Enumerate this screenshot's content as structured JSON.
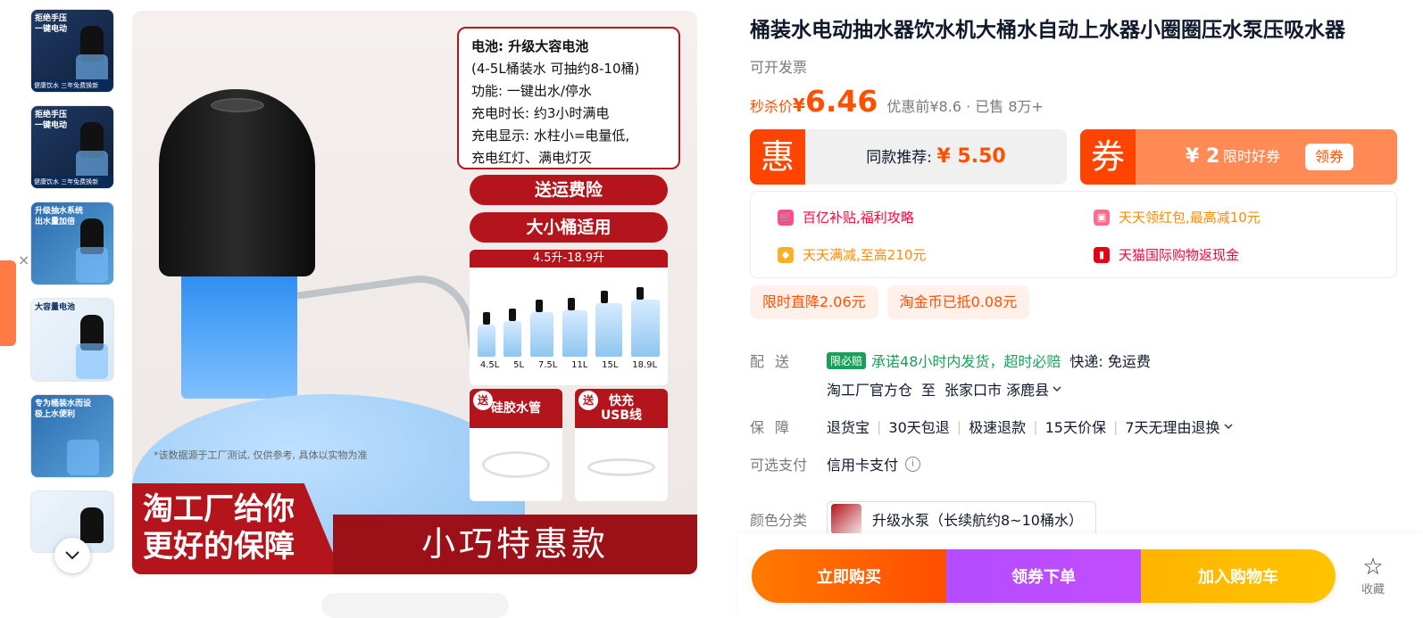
{
  "thumbnails": [
    {
      "tag": "拒绝手压\n一键电动",
      "foot": "健康饮水  三年免费换新",
      "style": "dark"
    },
    {
      "tag": "拒绝手压\n一键电动",
      "foot": "健康饮水  三年免费换新",
      "style": "dark"
    },
    {
      "tag": "升级抽水系统\n出水量加倍",
      "foot": "",
      "style": "blue"
    },
    {
      "tag": "大容量电池",
      "foot": "",
      "style": "light"
    },
    {
      "tag": "专为桶装水而设\n极上水便利",
      "foot": "",
      "style": "blue"
    },
    {
      "tag": "",
      "foot": "",
      "style": "light"
    }
  ],
  "main_image": {
    "specs": [
      "电池: 升级大容电池",
      "(4-5L桶装水 可抽约8-10桶)",
      "功能: 一键出水/停水",
      "充电时长: 约3小时满电",
      "充电显示: 水柱小=电量低,",
      "充电红灯、满电灯灭"
    ],
    "pill_1": "送运费险",
    "pill_2": "大小桶适用",
    "size_header": "4.5升-18.9升",
    "sizes": [
      "4.5L",
      "5L",
      "7.5L",
      "11L",
      "15L",
      "18.9L"
    ],
    "gift_1": "硅胶水管",
    "gift_2_line1": "快充",
    "gift_2_line2": "USB线",
    "gift_badge": "送",
    "disclaimer": "*该数据源于工厂测试, 仅供参考, 具体以实物为准",
    "promo_left_1": "淘工厂给你",
    "promo_left_2": "更好的保障",
    "promo_right": "小巧特惠款"
  },
  "product": {
    "title": "桶装水电动抽水器饮水机大桶水自动上水器小圈圈压水泵压吸水器",
    "subtitle": "可开发票",
    "price_label": "秒杀价",
    "currency": "¥",
    "price": "6.46",
    "price_meta": "优惠前¥8.6 · 已售 8万+"
  },
  "rec_card": {
    "icon": "惠",
    "label": "同款推荐: ",
    "price": "¥ 5.50"
  },
  "coupon_card": {
    "icon": "券",
    "amount": "¥ 2",
    "desc": "限时好券",
    "button": "领券"
  },
  "benefits": [
    {
      "text": "百亿补贴,福利攻略",
      "color": "#ff0036"
    },
    {
      "text": "天天领红包,最高减10元",
      "color": "#ff8a00"
    },
    {
      "text": "天天满减,至高210元",
      "color": "#ff8a00"
    },
    {
      "text": "天猫国际购物返现金",
      "color": "#ff0036"
    }
  ],
  "chips": [
    "限时直降2.06元",
    "淘金币已抵0.08元"
  ],
  "delivery": {
    "label": "配送",
    "badge": "限必赔",
    "promise": "承诺48小时内发货，超时必赔",
    "shipping": "快递: 免运费",
    "from": "淘工厂官方仓",
    "to_word": "至",
    "destination": "张家口市 涿鹿县"
  },
  "guarantee": {
    "label": "保障",
    "items": [
      "退货宝",
      "30天包退",
      "极速退款",
      "15天价保",
      "7天无理由退换"
    ]
  },
  "payment": {
    "label": "可选支付",
    "value": "信用卡支付"
  },
  "sku": {
    "label": "颜色分类",
    "value": "升级水泵（长续航约8~10桶水）"
  },
  "actions": {
    "buy_now": "立即购买",
    "coupon_order": "领券下单",
    "add_cart": "加入购物车",
    "favorite": "收藏"
  },
  "colors": {
    "accent": "#ff5000",
    "brand_red": "#b4141b",
    "green": "#18a058"
  }
}
